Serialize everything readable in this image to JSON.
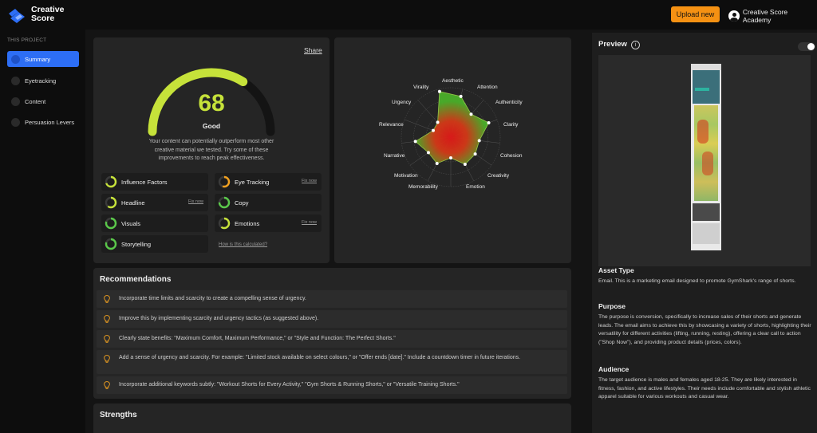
{
  "app": {
    "name": "Creative Score"
  },
  "header": {
    "upload_label": "Upload new",
    "account_label": "Creative Score Academy"
  },
  "sidebar": {
    "section_label": "THIS PROJECT",
    "items": [
      {
        "label": "Summary",
        "active": true
      },
      {
        "label": "Eyetracking",
        "active": false
      },
      {
        "label": "Content",
        "active": false
      },
      {
        "label": "Persuasion Levers",
        "active": false
      }
    ]
  },
  "score": {
    "share_label": "Share",
    "value": "68",
    "rating": "Good",
    "gauge_fraction": 0.68,
    "description": "Your content can potentially outperform most other creative material we tested. Try some of these improvements to reach peak effectiveness.",
    "accent_color": "#c6e23a",
    "factors": [
      {
        "label": "Influence Factors",
        "link": "",
        "color": "#c6e23a",
        "level": 0.7
      },
      {
        "label": "Eye Tracking",
        "link": "Fix now",
        "color": "#f0a020",
        "level": 0.55
      },
      {
        "label": "Headline",
        "link": "Fix now",
        "color": "#c6e23a",
        "level": 0.6
      },
      {
        "label": "Copy",
        "link": "",
        "color": "#5ac84a",
        "level": 0.75
      },
      {
        "label": "Visuals",
        "link": "",
        "color": "#5ac84a",
        "level": 0.8
      },
      {
        "label": "Emotions",
        "link": "Fix now",
        "color": "#c6e23a",
        "level": 0.6
      },
      {
        "label": "Storytelling",
        "link": "",
        "color": "#5ac84a",
        "level": 0.8
      }
    ],
    "how_link": "How is this calculated?"
  },
  "radar": {
    "labels": [
      "Aesthetic",
      "Attention",
      "Authenticity",
      "Clarity",
      "Cohesion",
      "Creativity",
      "Emotion",
      "Memorability",
      "Motivation",
      "Narrative",
      "Relevance",
      "Urgency",
      "Virality"
    ]
  },
  "recommendations": {
    "title": "Recommendations",
    "items": [
      "Incorporate time limits and scarcity to create a compelling sense of urgency.",
      "Improve this by implementing scarcity and urgency tactics (as suggested above).",
      "Clearly state benefits: \"Maximum Comfort, Maximum Performance,\" or \"Style and Function: The Perfect Shorts.\"",
      "Add a sense of urgency and scarcity. For example: \"Limited stock available on select colours,\" or \"Offer ends [date].\" Include a countdown timer in future iterations.",
      "Incorporate additional keywords subtly: \"Workout Shorts for Every Activity,\" \"Gym Shorts & Running Shorts,\" or \"Versatile Training Shorts.\""
    ]
  },
  "strengths": {
    "title": "Strengths"
  },
  "preview": {
    "title": "Preview",
    "asset_type_heading": "Asset Type",
    "asset_type_text": "Email. This is a marketing email designed to promote GymShark's range of shorts.",
    "purpose_heading": "Purpose",
    "purpose_text": "The purpose is conversion, specifically to increase sales of their shorts and generate leads. The email aims to achieve this by showcasing a variety of shorts, highlighting their versatility for different activities (lifting, running, resting), offering a clear call to action (\"Shop Now\"), and providing product details (prices, colors).",
    "audience_heading": "Audience",
    "audience_text": "The target audience is males and females aged 18-25. They are likely interested in fitness, fashion, and active lifestyles. Their needs include comfortable and stylish athletic apparel suitable for various workouts and casual wear."
  }
}
